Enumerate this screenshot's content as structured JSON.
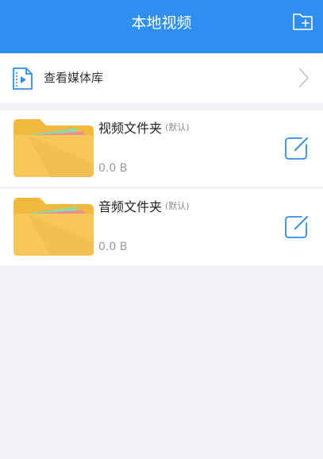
{
  "header": {
    "title": "本地视频",
    "new_folder_icon": "folder-plus-icon"
  },
  "media_library": {
    "label": "查看媒体库",
    "icon": "video-file-icon",
    "chevron_icon": "chevron-right-icon"
  },
  "folders": [
    {
      "name": "视频文件夹",
      "tag": "(默认)",
      "size": "0.0 B"
    },
    {
      "name": "音频文件夹",
      "tag": "(默认)",
      "size": "0.0 B"
    }
  ],
  "colors": {
    "accent": "#2f8ff0",
    "background": "#f1f2f6",
    "folder": "#f7c759",
    "folder_back": "#f1ba3e"
  }
}
